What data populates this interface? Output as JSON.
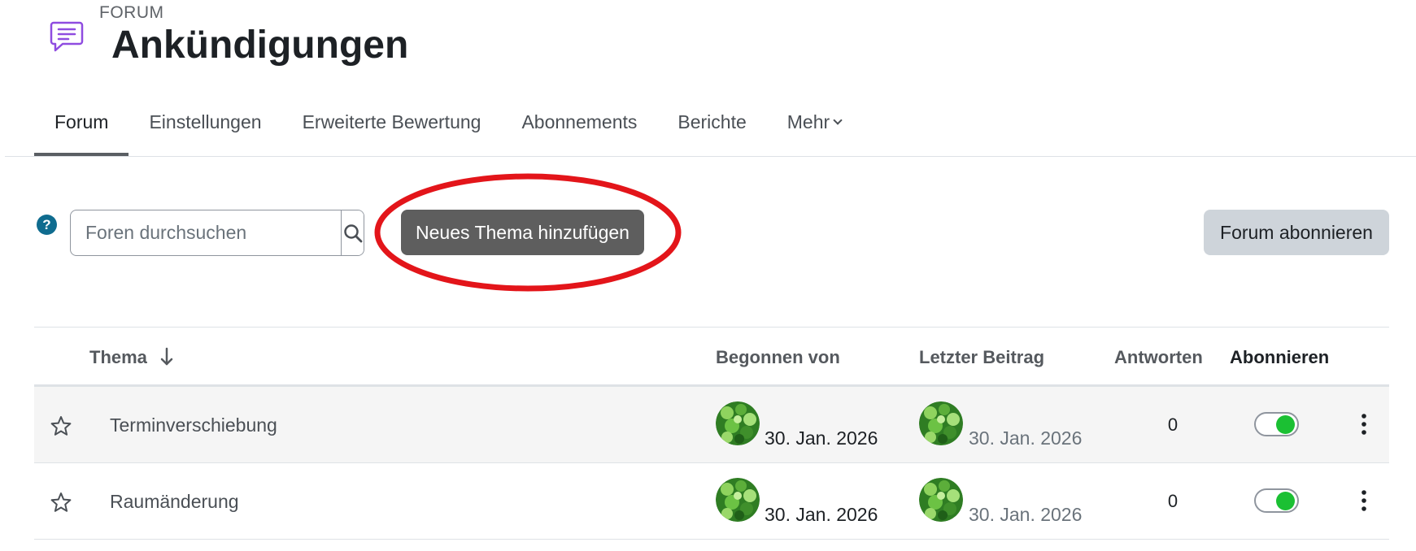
{
  "header": {
    "activity_type": "FORUM",
    "title": "Ankündigungen",
    "icon": "forum-chat-icon",
    "icon_color": "#8f4ce0"
  },
  "tabs": [
    {
      "label": "Forum",
      "active": true
    },
    {
      "label": "Einstellungen",
      "active": false
    },
    {
      "label": "Erweiterte Bewertung",
      "active": false
    },
    {
      "label": "Abonnements",
      "active": false
    },
    {
      "label": "Berichte",
      "active": false
    },
    {
      "label": "Mehr",
      "active": false,
      "icon": "chevron-down-icon"
    }
  ],
  "toolbar": {
    "help_icon": "question-icon",
    "help_glyph": "?",
    "search_placeholder": "Foren durchsuchen",
    "search_icon": "search-icon",
    "new_topic_label": "Neues Thema hinzufügen",
    "subscribe_label": "Forum abonnieren",
    "highlight_color": "#e3151a"
  },
  "table": {
    "headers": {
      "topic": "Thema",
      "started_by": "Begonnen von",
      "last_post": "Letzter Beitrag",
      "replies": "Antworten",
      "subscribe": "Abonnieren"
    },
    "sort_icon": "arrow-down-icon",
    "rows": [
      {
        "topic": "Terminverschiebung",
        "started_date": "30. Jan. 2026",
        "last_post_date": "30. Jan. 2026",
        "replies": "0",
        "subscribed": true
      },
      {
        "topic": "Raumänderung",
        "started_date": "30. Jan. 2026",
        "last_post_date": "30. Jan. 2026",
        "replies": "0",
        "subscribed": true
      }
    ]
  },
  "colors": {
    "toggle_on": "#1bc033",
    "help_badge": "#0f6c8f",
    "new_topic_button": "#5e5e5e",
    "subscribe_button": "#ced4da"
  }
}
